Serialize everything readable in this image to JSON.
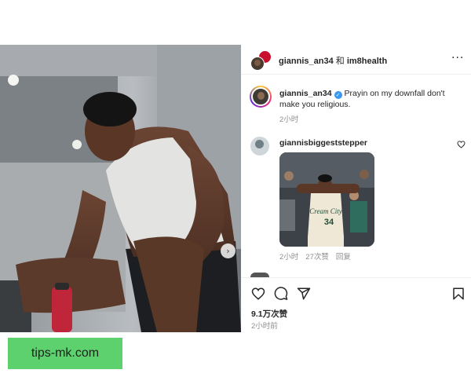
{
  "post": {
    "header": {
      "user1": "giannis_an34",
      "joiner": "和",
      "user2": "im8health",
      "more_icon": "more-horizontal-icon"
    },
    "caption": {
      "username": "giannis_an34",
      "verified_icon": "verified-badge-icon",
      "text": "Prayin on my downfall don't make you religious.",
      "time": "2小时"
    },
    "comment": {
      "username": "giannisbiggeststepper",
      "image_jersey_text": "Cream City",
      "image_jersey_number": "34",
      "time": "2小时",
      "likes": "27次赞",
      "reply": "回复",
      "like_icon": "heart-outline-icon"
    },
    "actions": {
      "like_icon": "heart-outline-icon",
      "comment_icon": "comment-bubble-icon",
      "share_icon": "paper-plane-icon",
      "save_icon": "bookmark-icon",
      "likes_count": "9.1万次赞",
      "post_time": "2小时前"
    }
  },
  "watermark": {
    "text": "tips-mk.com",
    "color": "#5dd16e"
  },
  "colors": {
    "text": "#262626",
    "secondary": "#8e8e8e",
    "verified": "#3897f0",
    "brand_red": "#c8102e"
  }
}
